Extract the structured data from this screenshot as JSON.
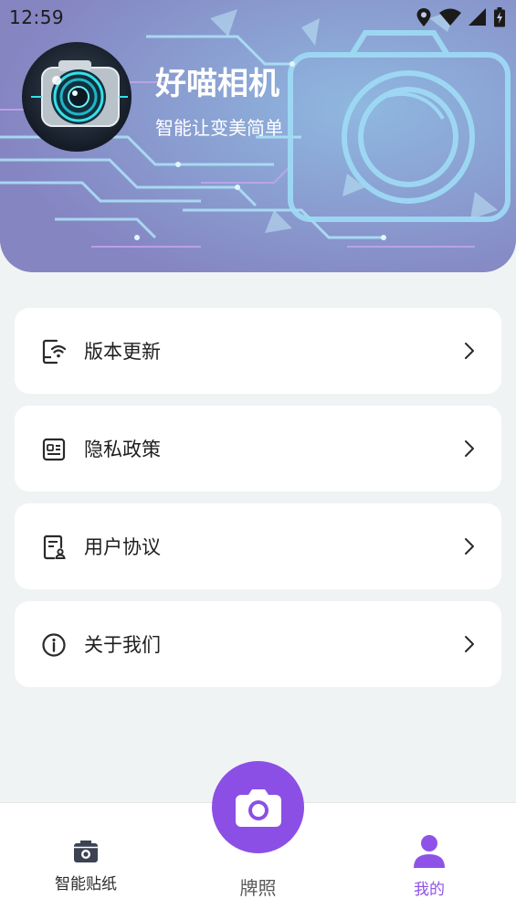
{
  "status_bar": {
    "time": "12:59",
    "icons": [
      "location-icon",
      "wifi-icon",
      "signal-icon",
      "battery-charging-icon"
    ]
  },
  "profile": {
    "avatar_icon": "camera-lens-icon",
    "app_name": "好喵相机",
    "slogan": "智能让变美简单"
  },
  "menu": {
    "items": [
      {
        "label": "版本更新",
        "icon": "update-phone-icon"
      },
      {
        "label": "隐私政策",
        "icon": "privacy-id-card-icon"
      },
      {
        "label": "用户协议",
        "icon": "user-agreement-icon"
      },
      {
        "label": "关于我们",
        "icon": "info-icon"
      }
    ]
  },
  "tabbar": {
    "tabs": [
      {
        "label": "智能贴纸",
        "icon": "camera-film-icon",
        "active": false
      },
      {
        "label": "牌照",
        "icon": "camera-icon",
        "active": false
      },
      {
        "label": "我的",
        "icon": "user-icon",
        "active": true
      }
    ]
  },
  "colors": {
    "accent": "#8b4fe6",
    "active_tab": "#8f52e8",
    "header_purple": "#8d8fc7",
    "page_bg": "#f0f3f4"
  }
}
